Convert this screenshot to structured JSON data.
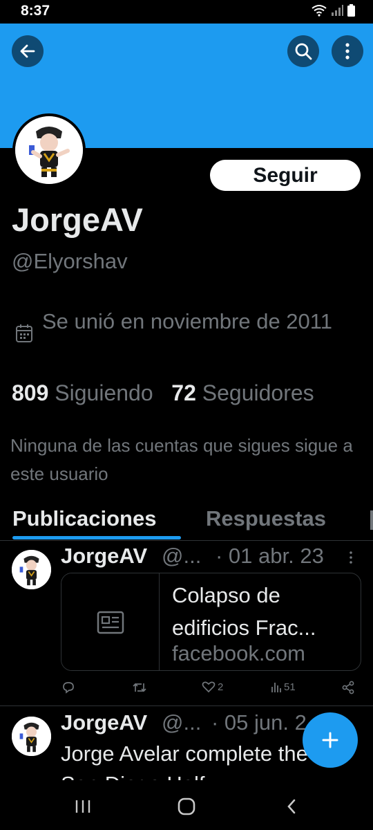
{
  "status_bar": {
    "time": "8:37"
  },
  "profile": {
    "follow_label": "Seguir",
    "display_name": "JorgeAV",
    "handle": "@Elyorshav",
    "joined": "Se unió en noviembre de 2011",
    "following_count": "809",
    "following_label": "Siguiendo",
    "followers_count": "72",
    "followers_label": "Seguidores",
    "mutual_note": "Ninguna de las cuentas que sigues sigue a este usuario"
  },
  "tabs": [
    {
      "label": "Publicaciones",
      "active": true
    },
    {
      "label": "Respuestas",
      "active": false
    }
  ],
  "tweets": [
    {
      "name": "JorgeAV",
      "handle": "@...",
      "date": "· 01 abr. 23",
      "card": {
        "title": "Colapso de edificios Frac...",
        "domain": "facebook.com"
      },
      "replies": "",
      "retweets": "",
      "likes": "2",
      "views": "51"
    },
    {
      "name": "JorgeAV",
      "handle": "@...",
      "date": "· 05 jun. 2",
      "text": "Jorge Avelar complete the PnP San Diego Half"
    }
  ],
  "colors": {
    "accent": "#1d9bf0",
    "background": "#000000",
    "secondary_text": "#71767b",
    "banner": "#1d9bf0"
  },
  "icons": [
    "back-arrow-icon",
    "search-icon",
    "more-vertical-icon",
    "calendar-icon",
    "link-card-icon",
    "reply-icon",
    "retweet-icon",
    "like-icon",
    "views-icon",
    "share-icon",
    "plus-icon",
    "recents-icon",
    "home-icon",
    "back-icon"
  ]
}
